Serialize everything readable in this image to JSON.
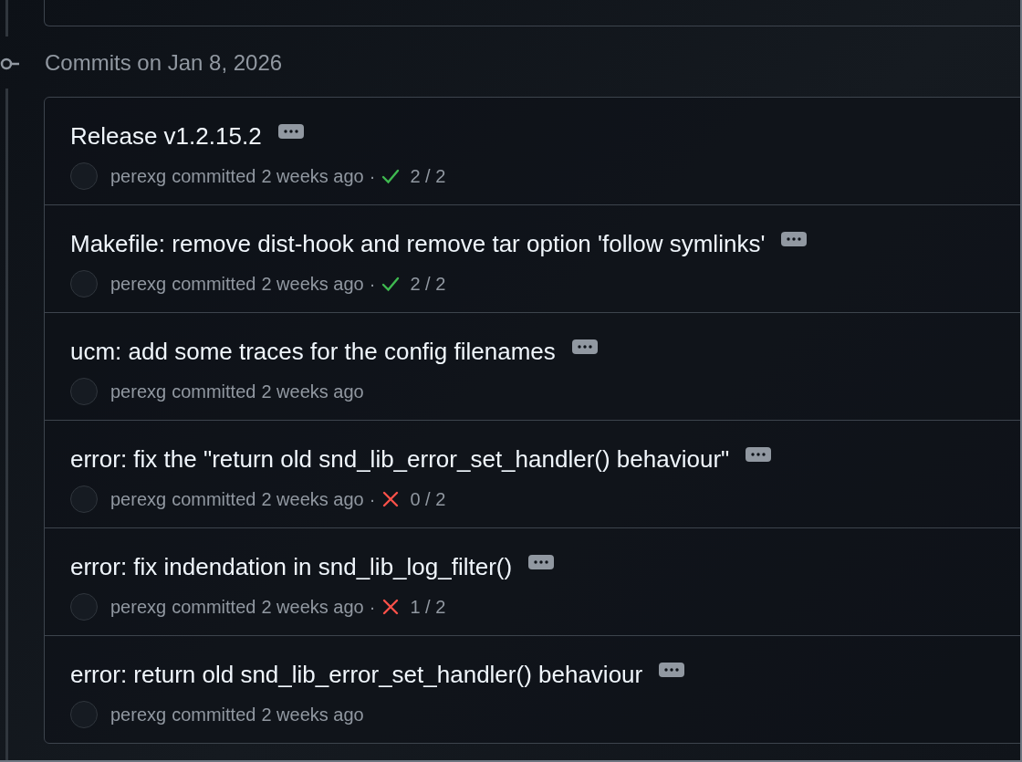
{
  "date_heading": "Commits on Jan 8, 2026",
  "commits": [
    {
      "title": "Release v1.2.15.2",
      "author": "perexg",
      "action": "committed",
      "time": "2 weeks ago",
      "separator": "·",
      "checks": {
        "passed": true,
        "count": "2 / 2"
      }
    },
    {
      "title": "Makefile: remove dist-hook and remove tar option 'follow symlinks'",
      "author": "perexg",
      "action": "committed",
      "time": "2 weeks ago",
      "separator": "·",
      "checks": {
        "passed": true,
        "count": "2 / 2"
      }
    },
    {
      "title": "ucm: add some traces for the config filenames",
      "author": "perexg",
      "action": "committed",
      "time": "2 weeks ago"
    },
    {
      "title": "error: fix the \"return old snd_lib_error_set_handler() behaviour\"",
      "author": "perexg",
      "action": "committed",
      "time": "2 weeks ago",
      "separator": "·",
      "checks": {
        "passed": false,
        "count": "0 / 2"
      }
    },
    {
      "title": "error: fix indendation in snd_lib_log_filter()",
      "author": "perexg",
      "action": "committed",
      "time": "2 weeks ago",
      "separator": "·",
      "checks": {
        "passed": false,
        "count": "1 / 2"
      }
    },
    {
      "title": "error: return old snd_lib_error_set_handler() behaviour",
      "author": "perexg",
      "action": "committed",
      "time": "2 weeks ago"
    }
  ]
}
